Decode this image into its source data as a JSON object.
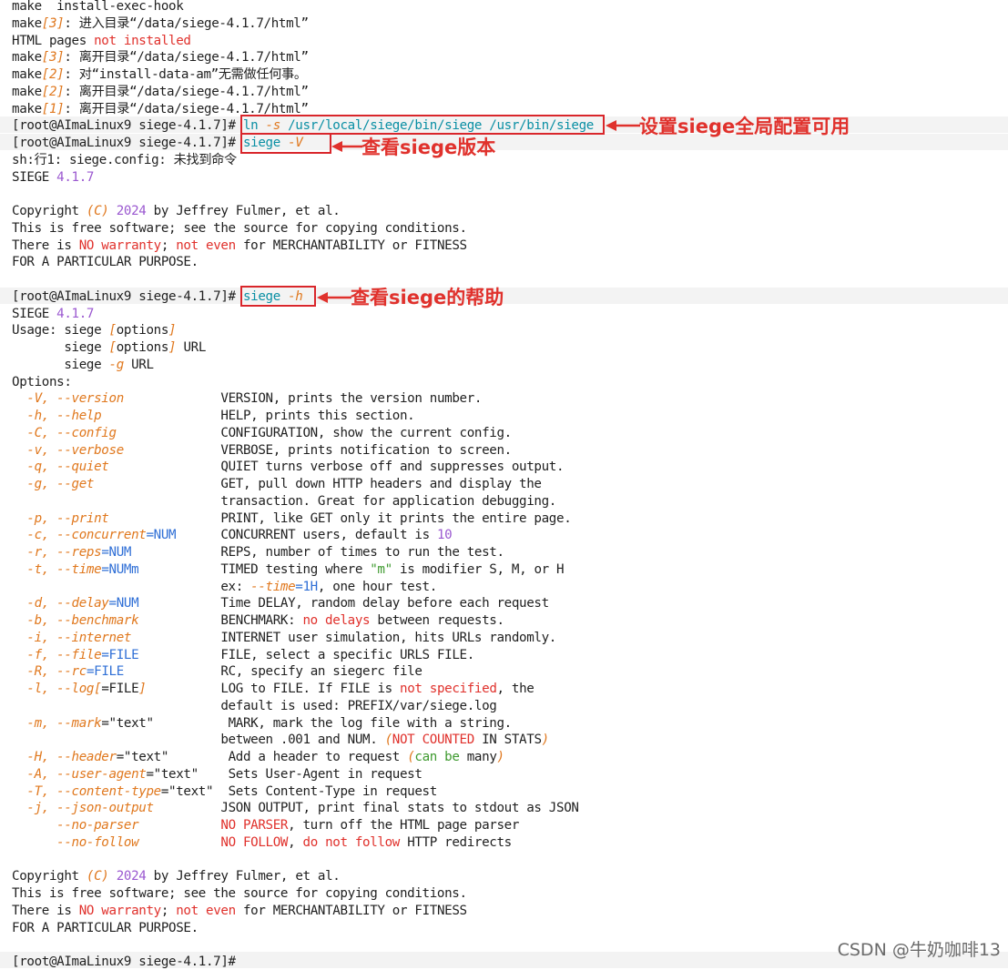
{
  "palette": {
    "background": "#ffffff",
    "text": "#1f1f1f",
    "option": "#e0781e",
    "emphasis": "#e0312c",
    "highlight": "#0a8fa4",
    "number": "#9b59d0",
    "keyword": "#2f6fd6",
    "annotation": "#e0312c"
  },
  "prompt": "[root@AImaLinux9 siege-4.1.7]# ",
  "lines": [
    [
      [
        "plain",
        "make  install-exec-hook"
      ]
    ],
    [
      [
        "plain",
        "make"
      ],
      [
        "opt",
        "[3]"
      ],
      [
        "plain",
        ": 进入目录“/data/siege-4.1.7/html”"
      ]
    ],
    [
      [
        "plain",
        "HTML pages "
      ],
      [
        "red",
        "not installed"
      ]
    ],
    [
      [
        "plain",
        "make"
      ],
      [
        "opt",
        "[3]"
      ],
      [
        "plain",
        ": 离开目录“/data/siege-4.1.7/html”"
      ]
    ],
    [
      [
        "plain",
        "make"
      ],
      [
        "opt",
        "[2]"
      ],
      [
        "plain",
        ": 对“install-data-am”无需做任何事。"
      ]
    ],
    [
      [
        "plain",
        "make"
      ],
      [
        "opt",
        "[2]"
      ],
      [
        "plain",
        ": 离开目录“/data/siege-4.1.7/html”"
      ]
    ],
    [
      [
        "plain",
        "make"
      ],
      [
        "opt",
        "[1]"
      ],
      [
        "plain",
        ": 离开目录“/data/siege-4.1.7/html”"
      ]
    ],
    [
      [
        "plain",
        "[root@AImaLinux9 siege-4.1.7]# "
      ],
      [
        "cyan",
        "ln "
      ],
      [
        "opt",
        "-s"
      ],
      [
        "cyan",
        " /usr/local/siege/bin/siege /usr/bin/siege"
      ]
    ],
    [
      [
        "plain",
        "[root@AImaLinux9 siege-4.1.7]# "
      ],
      [
        "cyan",
        "siege "
      ],
      [
        "opt",
        "-V"
      ]
    ],
    [
      [
        "plain",
        "sh:行1: siege.config: 未找到命令"
      ]
    ],
    [
      [
        "plain",
        "SIEGE "
      ],
      [
        "num",
        "4.1.7"
      ]
    ],
    [],
    [
      [
        "plain",
        "Copyright "
      ],
      [
        "opt",
        "(C)"
      ],
      [
        "plain",
        " "
      ],
      [
        "num",
        "2024"
      ],
      [
        "plain",
        " by Jeffrey Fulmer, et al."
      ]
    ],
    [
      [
        "plain",
        "This is free software; see the source for copying conditions."
      ]
    ],
    [
      [
        "plain",
        "There is "
      ],
      [
        "red",
        "NO warranty"
      ],
      [
        "plain",
        "; "
      ],
      [
        "red",
        "not even"
      ],
      [
        "plain",
        " for MERCHANTABILITY or FITNESS"
      ]
    ],
    [
      [
        "plain",
        "FOR A PARTICULAR PURPOSE."
      ]
    ],
    [],
    [
      [
        "plain",
        "[root@AImaLinux9 siege-4.1.7]# "
      ],
      [
        "cyan",
        "siege "
      ],
      [
        "opt",
        "-h"
      ]
    ],
    [
      [
        "plain",
        "SIEGE "
      ],
      [
        "num",
        "4.1.7"
      ]
    ],
    [
      [
        "plain",
        "Usage: siege "
      ],
      [
        "opt",
        "["
      ],
      [
        "plain",
        "options"
      ],
      [
        "opt",
        "]"
      ]
    ],
    [
      [
        "plain",
        "       siege "
      ],
      [
        "opt",
        "["
      ],
      [
        "plain",
        "options"
      ],
      [
        "opt",
        "]"
      ],
      [
        "plain",
        " URL"
      ]
    ],
    [
      [
        "plain",
        "       siege "
      ],
      [
        "opt",
        "-g"
      ],
      [
        "plain",
        " URL"
      ]
    ],
    [
      [
        "plain",
        "Options:"
      ]
    ],
    [
      [
        "plain",
        "  "
      ],
      [
        "opt",
        "-V, --version"
      ],
      [
        "plain",
        "             VERSION, prints the version number."
      ]
    ],
    [
      [
        "plain",
        "  "
      ],
      [
        "opt",
        "-h, --help"
      ],
      [
        "plain",
        "                HELP, prints this section."
      ]
    ],
    [
      [
        "plain",
        "  "
      ],
      [
        "opt",
        "-C, --config"
      ],
      [
        "plain",
        "              CONFIGURATION, show the current config."
      ]
    ],
    [
      [
        "plain",
        "  "
      ],
      [
        "opt",
        "-v, --verbose"
      ],
      [
        "plain",
        "             VERBOSE, prints notification to screen."
      ]
    ],
    [
      [
        "plain",
        "  "
      ],
      [
        "opt",
        "-q, --quiet"
      ],
      [
        "plain",
        "               QUIET turns verbose off and suppresses output."
      ]
    ],
    [
      [
        "plain",
        "  "
      ],
      [
        "opt",
        "-g, --get"
      ],
      [
        "plain",
        "                 GET, pull down HTTP headers and display the"
      ]
    ],
    [
      [
        "plain",
        "                            transaction. Great for application debugging."
      ]
    ],
    [
      [
        "plain",
        "  "
      ],
      [
        "opt",
        "-p, --print"
      ],
      [
        "plain",
        "               PRINT, like GET only it prints the entire page."
      ]
    ],
    [
      [
        "plain",
        "  "
      ],
      [
        "opt",
        "-c, --concurrent"
      ],
      [
        "blue",
        "=NUM"
      ],
      [
        "plain",
        "      CONCURRENT users, default is "
      ],
      [
        "num",
        "10"
      ]
    ],
    [
      [
        "plain",
        "  "
      ],
      [
        "opt",
        "-r, --reps"
      ],
      [
        "blue",
        "=NUM"
      ],
      [
        "plain",
        "            REPS, number of times to run the test."
      ]
    ],
    [
      [
        "plain",
        "  "
      ],
      [
        "opt",
        "-t, --time"
      ],
      [
        "blue",
        "=NUMm"
      ],
      [
        "plain",
        "           TIMED testing where "
      ],
      [
        "grn",
        "\"m\""
      ],
      [
        "plain",
        " is modifier S, M, or H"
      ]
    ],
    [
      [
        "plain",
        "                            ex: "
      ],
      [
        "opt",
        "--time"
      ],
      [
        "blue",
        "=1H"
      ],
      [
        "plain",
        ", one hour test."
      ]
    ],
    [
      [
        "plain",
        "  "
      ],
      [
        "opt",
        "-d, --delay"
      ],
      [
        "blue",
        "=NUM"
      ],
      [
        "plain",
        "           Time DELAY, random delay before each request"
      ]
    ],
    [
      [
        "plain",
        "  "
      ],
      [
        "opt",
        "-b, --benchmark"
      ],
      [
        "plain",
        "           BENCHMARK: "
      ],
      [
        "red",
        "no delays"
      ],
      [
        "plain",
        " between requests."
      ]
    ],
    [
      [
        "plain",
        "  "
      ],
      [
        "opt",
        "-i, --internet"
      ],
      [
        "plain",
        "            INTERNET user simulation, hits URLs randomly."
      ]
    ],
    [
      [
        "plain",
        "  "
      ],
      [
        "opt",
        "-f, --file"
      ],
      [
        "blue",
        "=FILE"
      ],
      [
        "plain",
        "           FILE, select a specific URLS FILE."
      ]
    ],
    [
      [
        "plain",
        "  "
      ],
      [
        "opt",
        "-R, --rc"
      ],
      [
        "blue",
        "=FILE"
      ],
      [
        "plain",
        "             RC, specify an siegerc file"
      ]
    ],
    [
      [
        "plain",
        "  "
      ],
      [
        "opt",
        "-l, --log"
      ],
      [
        "opt",
        "["
      ],
      [
        "plain",
        "=FILE"
      ],
      [
        "opt",
        "]"
      ],
      [
        "plain",
        "          LOG to FILE. If FILE is "
      ],
      [
        "red",
        "not specified"
      ],
      [
        "plain",
        ", the"
      ]
    ],
    [
      [
        "plain",
        "                            default is used: PREFIX/var/siege.log"
      ]
    ],
    [
      [
        "plain",
        "  "
      ],
      [
        "opt",
        "-m, --mark"
      ],
      [
        "plain",
        "=\"text\"          MARK, mark the log file with a string."
      ]
    ],
    [
      [
        "plain",
        "                            between .001 and NUM. "
      ],
      [
        "opt",
        "("
      ],
      [
        "red",
        "NOT COUNTED"
      ],
      [
        "plain",
        " IN STATS"
      ],
      [
        "opt",
        ")"
      ]
    ],
    [
      [
        "plain",
        "  "
      ],
      [
        "opt",
        "-H, --header"
      ],
      [
        "plain",
        "=\"text\"        Add a header to request "
      ],
      [
        "opt",
        "("
      ],
      [
        "grn",
        "can be"
      ],
      [
        "plain",
        " many"
      ],
      [
        "opt",
        ")"
      ]
    ],
    [
      [
        "plain",
        "  "
      ],
      [
        "opt",
        "-A, --user-agent"
      ],
      [
        "plain",
        "=\"text\"    Sets User-Agent in request"
      ]
    ],
    [
      [
        "plain",
        "  "
      ],
      [
        "opt",
        "-T, --content-type"
      ],
      [
        "plain",
        "=\"text\"  Sets Content-Type in request"
      ]
    ],
    [
      [
        "plain",
        "  "
      ],
      [
        "opt",
        "-j, --json-output"
      ],
      [
        "plain",
        "         JSON OUTPUT, print final stats to stdout as JSON"
      ]
    ],
    [
      [
        "plain",
        "      "
      ],
      [
        "opt",
        "--no-parser"
      ],
      [
        "plain",
        "           "
      ],
      [
        "red",
        "NO PARSER"
      ],
      [
        "plain",
        ", turn off the HTML page parser"
      ]
    ],
    [
      [
        "plain",
        "      "
      ],
      [
        "opt",
        "--no-follow"
      ],
      [
        "plain",
        "           "
      ],
      [
        "red",
        "NO FOLLOW"
      ],
      [
        "plain",
        ", "
      ],
      [
        "red",
        "do not follow"
      ],
      [
        "plain",
        " HTTP redirects"
      ]
    ],
    [],
    [
      [
        "plain",
        "Copyright "
      ],
      [
        "opt",
        "(C)"
      ],
      [
        "plain",
        " "
      ],
      [
        "num",
        "2024"
      ],
      [
        "plain",
        " by Jeffrey Fulmer, et al."
      ]
    ],
    [
      [
        "plain",
        "This is free software; see the source for copying conditions."
      ]
    ],
    [
      [
        "plain",
        "There is "
      ],
      [
        "red",
        "NO warranty"
      ],
      [
        "plain",
        "; "
      ],
      [
        "red",
        "not even"
      ],
      [
        "plain",
        " for MERCHANTABILITY or FITNESS"
      ]
    ],
    [
      [
        "plain",
        "FOR A PARTICULAR PURPOSE."
      ]
    ],
    [],
    [
      [
        "plain",
        "[root@AImaLinux9 siege-4.1.7]# "
      ]
    ]
  ],
  "annotations": {
    "ln": "设置siege全局配置可用",
    "version": "查看siege版本",
    "help": "查看siege的帮助"
  },
  "watermark": "CSDN @牛奶咖啡13"
}
